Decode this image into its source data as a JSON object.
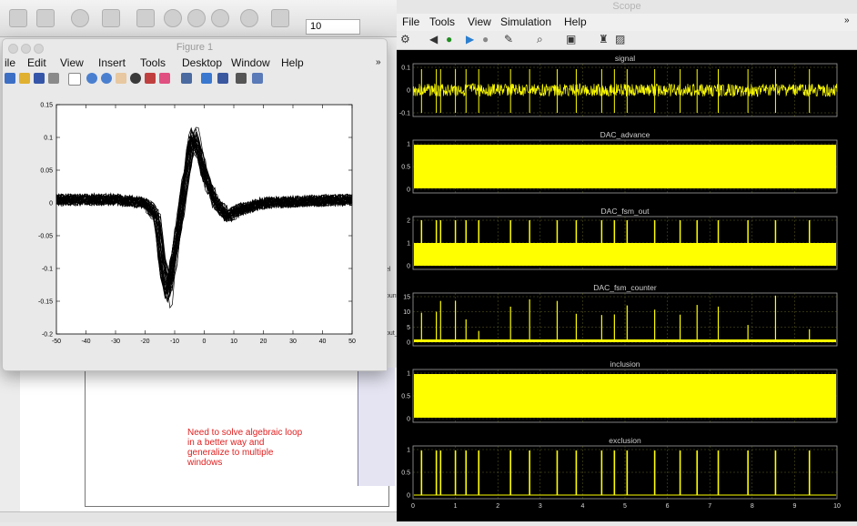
{
  "simulink": {
    "stop_time": "10",
    "annotation": "Need to solve algebraic loop\nin a better way and\ngeneralize to multiple\nwindows",
    "side_labels": [
      "el",
      "ounts",
      "out_"
    ]
  },
  "figure": {
    "title": "Figure 1",
    "menu": [
      "ile",
      "Edit",
      "View",
      "Insert",
      "Tools",
      "Desktop",
      "Window",
      "Help"
    ],
    "more_glyph": "»"
  },
  "scope": {
    "title": "Scope",
    "menu": [
      "File",
      "Tools",
      "View",
      "Simulation",
      "Help"
    ],
    "more_glyph": "»",
    "plot_titles": [
      "signal",
      "DAC_advance",
      "DAC_fsm_out",
      "DAC_fsm_counter",
      "inclusion",
      "exclusion"
    ],
    "y_ticks": [
      [
        "0.1",
        "0",
        "-0.1"
      ],
      [
        "1",
        "0.5",
        "0"
      ],
      [
        "2",
        "1",
        "0"
      ],
      [
        "15",
        "10",
        "5",
        "0"
      ],
      [
        "1",
        "0.5",
        "0"
      ],
      [
        "1",
        "0.5",
        "0"
      ]
    ],
    "x_ticks": [
      "0",
      "1",
      "2",
      "3",
      "4",
      "5",
      "6",
      "7",
      "8",
      "9",
      "10"
    ]
  },
  "colors": {
    "trace": "#ffff00",
    "scope_bg": "#000000",
    "grid": "#8a8a00",
    "annotation": "#e02020"
  },
  "chart_data": [
    {
      "type": "line",
      "title": "",
      "xlabel": "",
      "ylabel": "",
      "xlim": [
        -50,
        50
      ],
      "ylim": [
        -0.2,
        0.15
      ],
      "x_ticks": [
        "-50",
        "-40",
        "-30",
        "-20",
        "-10",
        "0",
        "10",
        "20",
        "30",
        "40",
        "50"
      ],
      "y_ticks": [
        "0.15",
        "0.1",
        "0.05",
        "0",
        "-0.05",
        "-0.1",
        "-0.15",
        "-0.2"
      ],
      "series": [
        {
          "x": [
            -50,
            -30,
            -20,
            -16,
            -14,
            -12,
            -9,
            -6,
            -4,
            -2,
            0,
            4,
            8,
            12,
            20,
            30,
            50
          ],
          "y": [
            0.005,
            0.005,
            0.0,
            -0.02,
            -0.1,
            -0.135,
            -0.05,
            0.04,
            0.1,
            0.085,
            0.045,
            0.0,
            -0.02,
            -0.01,
            0.0,
            0.002,
            0.005
          ]
        }
      ]
    }
  ]
}
